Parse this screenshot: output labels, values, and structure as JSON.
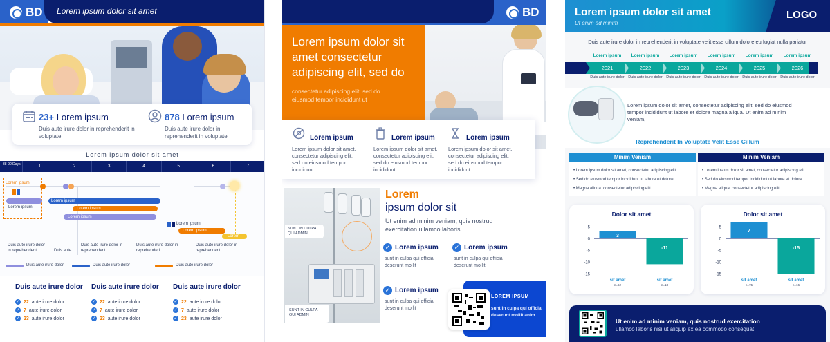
{
  "brand": {
    "name": "BD"
  },
  "colors": {
    "navy": "#0a1e6e",
    "orange": "#f07c00",
    "blue": "#2a73d8",
    "teal": "#0aa79c",
    "lightblue": "#1e8fd2",
    "purple": "#8f8fde"
  },
  "panel1": {
    "header_title": "Lorem ipsum dolor sit amet",
    "stat1": {
      "number": "23+",
      "label": "Lorem ipsum",
      "desc": "Duis aute irure dolor in reprehenderit in voluptate",
      "icon": "calendar-icon"
    },
    "stat2": {
      "number": "878",
      "label": "Lorem ipsum",
      "desc": "Duis aute irure dolor in reprehenderit in voluptate",
      "icon": "person-icon"
    },
    "timeline_title": "Lorem ipsum dolor sit amet",
    "days_label": "38-90 Days",
    "days": [
      "1",
      "2",
      "3",
      "4",
      "5",
      "6",
      "7"
    ],
    "tags": {
      "orange_box": "Lorem ipsum",
      "purple_pill": "Lorem ipsum",
      "blue_bar": "Lorem ipsum",
      "orange_bar": "Lorem ipsum",
      "purple_bar": "Lorem ipsum",
      "flag_label": "Lorem ipsum",
      "orange_pill2": "Lorem ipsum",
      "yellow_pill": "Lorem"
    },
    "bottom_notes": [
      "Duis aute irure dolor in reprehenderit",
      "Duis aute",
      "Duis aute irure dolor in reprehenderit",
      "Duis aute irure dolor in reprehenderit",
      "Duis aute irure dolor in reprehenderit"
    ],
    "legend": [
      "Duis aute irure dolor",
      "Duis aute irure dolor",
      "Duis aute irure dolor"
    ],
    "columns": [
      {
        "title": "Duis aute irure dolor",
        "items": [
          {
            "num": "22",
            "text": "aute irure dolor"
          },
          {
            "num": "7",
            "text": "aute irure dolor"
          },
          {
            "num": "23",
            "text": "aute irure dolor"
          }
        ]
      },
      {
        "title": "Duis aute irure dolor",
        "items": [
          {
            "num": "22",
            "text": "aute irure dolor"
          },
          {
            "num": "7",
            "text": "aute irure dolor"
          },
          {
            "num": "23",
            "text": "aute irure dolor"
          }
        ]
      },
      {
        "title": "Duis aute irure dolor",
        "items": [
          {
            "num": "22",
            "text": "aute irure dolor"
          },
          {
            "num": "7",
            "text": "aute irure dolor"
          },
          {
            "num": "23",
            "text": "aute irure dolor"
          }
        ]
      }
    ]
  },
  "panel2": {
    "hero_title": "Lorem ipsum dolor sit amet consectetur adipiscing elit, sed do",
    "hero_sub": "consectetur adipiscing elit, sed do eiusmod tempor incididunt ut",
    "features": [
      {
        "icon": "no-virus-icon",
        "title": "Lorem ipsum",
        "text": "Lorem ipsum dolor sit amet, consectetur adipiscing elit, sed do eiusmod tempor incididunt"
      },
      {
        "icon": "trash-icon",
        "title": "Lorem ipsum",
        "text": "Lorem ipsum dolor sit amet, consectetur adipiscing elit, sed do eiusmod tempor incididunt"
      },
      {
        "icon": "hourglass-icon",
        "title": "Lorem ipsum",
        "text": "Lorem ipsum dolor sit amet, consectetur adipiscing elit, sed do eiusmod tempor incididunt"
      }
    ],
    "callout_top": "SUNT IN CULPA QUI ADMIN",
    "callout_bottom": "SUNT IN CULPA QUI ADMIN",
    "section_title_orange": "Lorem",
    "section_title_navy": "ipsum dolor sit",
    "section_desc": "Ut enim ad minim veniam, quis nostrud exercitation ullamco laboris",
    "checks": [
      {
        "title": "Lorem ipsum",
        "text": "sunt in culpa qui officia deserunt mollit"
      },
      {
        "title": "Lorem ipsum",
        "text": "sunt in culpa qui officia deserunt mollit"
      },
      {
        "title": "Lorem ipsum",
        "text": "sunt in culpa qui officia deserunt mollit"
      }
    ],
    "qr_title": "LOREM IPSUM",
    "qr_text": "sunt in culpa qui officia deserunt mollit anim"
  },
  "panel3": {
    "title": "Lorem ipsum dolor sit amet",
    "subtitle": "Ut enim ad minim",
    "logo": "LOGO",
    "intro": "Duis aute irure dolor in reprehenderit in voluptate velit esse cillum dolore eu fugiat nulla pariatur",
    "timeline_labels": [
      "Lorem ipsum",
      "Lorem ipsum",
      "Lorem ipsum",
      "Lorem ipsum",
      "Lorem ipsum",
      "Lorem ipsum"
    ],
    "years": [
      "2021",
      "2022",
      "2023",
      "2024",
      "2025",
      "2026"
    ],
    "year_notes": [
      "Duis aute irure dolor",
      "Duis aute irure dolor",
      "Duis aute irure dolor",
      "Duis aute irure dolor",
      "Duis aute irure dolor",
      "Duis aute irure dolor"
    ],
    "device_text": "Lorem ipsum dolor sit amet, consectetur adipiscing elit, sed do eiusmod tempor incididunt ut labore et dolore magna aliqua. Ut enim ad minim veniam,",
    "reprehenderit": "Reprehenderit In Voluptate Velit Esse Cillum",
    "tables": [
      {
        "header": "Minim Veniam",
        "rows": [
          "Lorem ipsum dolor sit amet, consectetur adipiscing elit",
          "Sed do eiusmod tempor incididunt ut labore et dolore",
          "Magna aliqua. consectetur adipiscing elit"
        ]
      },
      {
        "header": "Minim Veniam",
        "rows": [
          "Lorem ipsum dolor sit amet, consectetur adipiscing elit",
          "Sed do eiusmod tempor incididunt ut labore et dolore",
          "Magna aliqua. consectetur adipiscing elit"
        ]
      }
    ],
    "footer_title": "Ut enim ad minim veniam, quis nostrud exercitation",
    "footer_text": "ullamco laboris nisi ut aliquip ex ea commodo consequat"
  },
  "chart_data": [
    {
      "type": "bar",
      "title": "Dolor sit amet",
      "categories": [
        "sit amet",
        "sit amet"
      ],
      "category_notes": [
        "n=62",
        "n=13"
      ],
      "values": [
        3,
        -11
      ],
      "colors": [
        "#1e8fd2",
        "#0aa79c"
      ],
      "yticks": [
        5,
        0,
        -5,
        -10,
        -15
      ],
      "ylim": [
        -15,
        5
      ]
    },
    {
      "type": "bar",
      "title": "Dolor sit amet",
      "categories": [
        "sit amet",
        "sit amet"
      ],
      "category_notes": [
        "n=75",
        "n=16"
      ],
      "values": [
        7,
        -15
      ],
      "colors": [
        "#1e8fd2",
        "#0aa79c"
      ],
      "yticks": [
        5,
        0,
        -5,
        -10,
        -15
      ],
      "ylim": [
        -15,
        5
      ]
    }
  ]
}
